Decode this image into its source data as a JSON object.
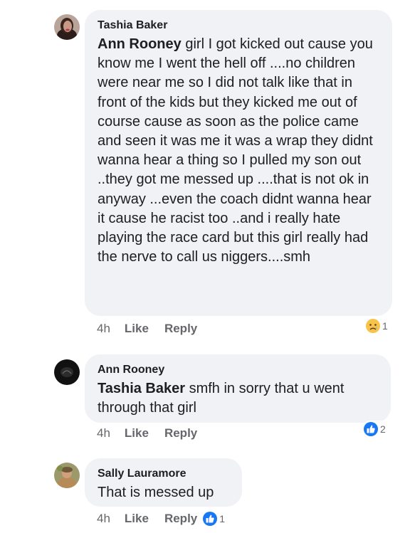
{
  "comments": [
    {
      "author": "Tashia Baker",
      "mention": "Ann Rooney",
      "text": " girl I got kicked out cause you know me I went the hell off ....no children were near me so I did not talk like that in front of the kids but they kicked me out of course cause as soon as the police came and seen it was me it was a wrap they didnt wanna hear a thing so I pulled my son out ..they got me messed up ....that is not ok in anyway ...even the coach didnt wanna hear it cause he racist too ..and i really hate playing the race card but this girl really had the nerve to call us niggers....smh",
      "time": "4h",
      "like_label": "Like",
      "reply_label": "Reply",
      "reaction_icon": "sad-face-icon",
      "reaction_count": "1"
    },
    {
      "author": "Ann Rooney",
      "mention": "Tashia Baker",
      "text": " smfh in sorry that u went through that girl",
      "time": "4h",
      "like_label": "Like",
      "reply_label": "Reply",
      "reaction_icon": "like-thumb-icon",
      "reaction_count": "2"
    },
    {
      "author": "Sally Lauramore",
      "mention": "",
      "text": "That is messed up",
      "time": "4h",
      "like_label": "Like",
      "reply_label": "Reply",
      "reaction_icon": "like-thumb-icon",
      "reaction_count": "1"
    }
  ],
  "colors": {
    "bubble": "#f0f2f5",
    "secondary_text": "#65676b",
    "like_blue": "#1877f2",
    "sad_yellow": "#f7c34a"
  }
}
